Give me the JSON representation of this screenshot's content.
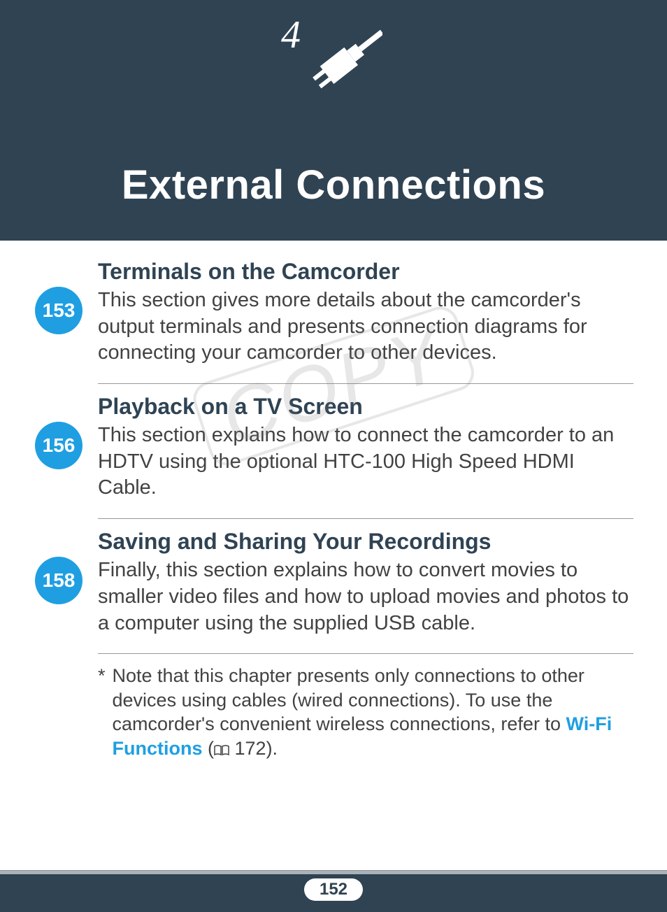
{
  "header": {
    "chapter_number": "4",
    "title": "External Connections"
  },
  "sections": [
    {
      "page": "153",
      "title": "Terminals on the Camcorder",
      "body": "This section gives more details about the camcorder's output terminals and presents connection diagrams for connecting your camcorder to other devices."
    },
    {
      "page": "156",
      "title": "Playback on a TV Screen",
      "body": "This section explains how to connect the camcorder to an HDTV using the optional HTC-100 High Speed HDMI Cable."
    },
    {
      "page": "158",
      "title": "Saving and Sharing Your Recordings",
      "body": "Finally, this section explains how to convert movies to smaller video files and how to upload movies and photos to a computer using the supplied USB cable."
    }
  ],
  "note": {
    "asterisk": "*",
    "text_before_link": "Note that this chapter presents only connections to other devices using cables (wired connections). To use the camcorder's convenient wireless connections, refer to ",
    "link_text": "Wi-Fi Functions",
    "ref_open": " (",
    "ref_page": " 172).",
    "book_glyph": "▭"
  },
  "footer": {
    "page_number": "152"
  },
  "watermark": "COPY"
}
